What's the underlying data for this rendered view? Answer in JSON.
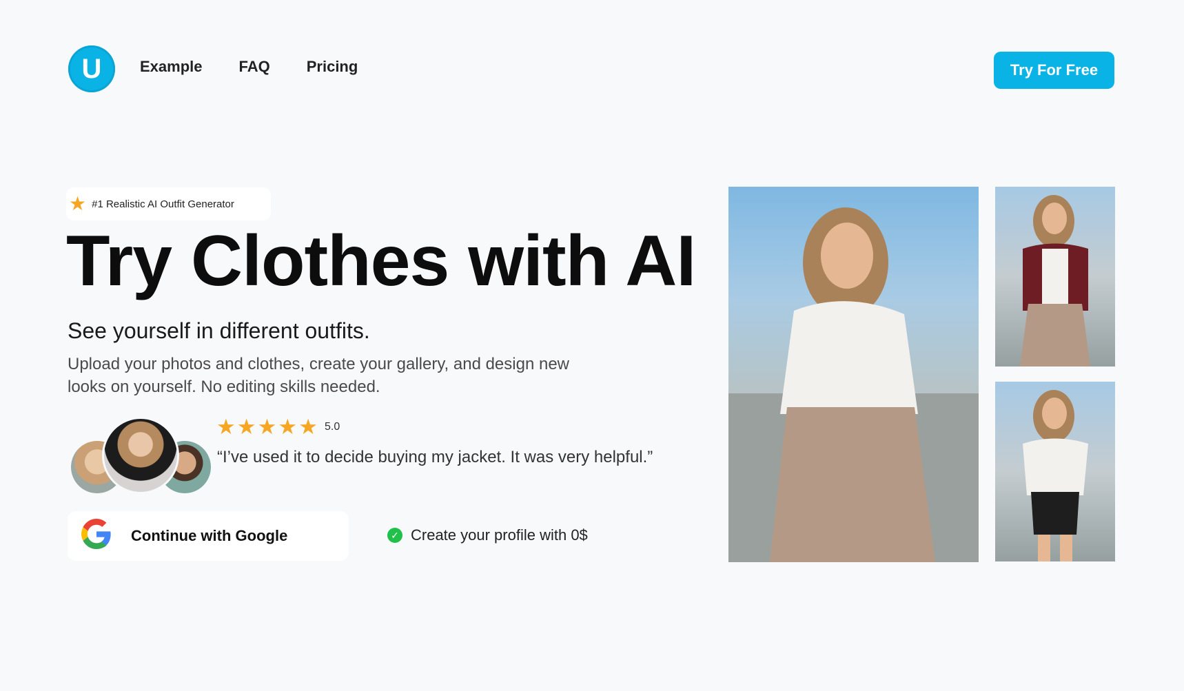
{
  "header": {
    "logo_letter": "U",
    "nav": [
      "Example",
      "FAQ",
      "Pricing"
    ],
    "cta_label": "Try For Free"
  },
  "hero": {
    "badge_text": "#1 Realistic AI Outfit Generator",
    "title": "Try Clothes with AI",
    "subtitle": "See yourself in different outfits.",
    "description": "Upload your photos and clothes, create your gallery, and design new looks on yourself. No editing skills needed.",
    "rating": "5.0",
    "star_count": 5,
    "quote": "“I’ve used it to decide buying my jacket. It was very helpful.”",
    "google_button_label": "Continue with Google",
    "profile_note": "Create your profile with 0$"
  },
  "colors": {
    "accent": "#0ab3e6",
    "star": "#f6a623",
    "check": "#21c04a",
    "background": "#f8f9fa"
  },
  "icons": [
    "star-icon",
    "google-icon",
    "check-circle-icon"
  ]
}
